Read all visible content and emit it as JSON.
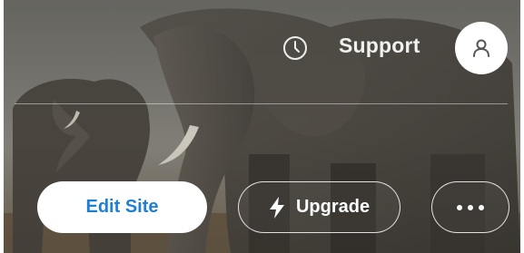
{
  "header": {
    "history_icon": "history-icon",
    "support_label": "Support",
    "account_icon": "user-icon"
  },
  "actions": {
    "edit_label": "Edit Site",
    "upgrade_label": "Upgrade",
    "upgrade_icon": "bolt-icon",
    "more_icon": "more-dots-icon"
  },
  "colors": {
    "edit_text": "#1e7fd6",
    "button_outline": "#ffffff",
    "avatar_bg": "#ffffff"
  }
}
